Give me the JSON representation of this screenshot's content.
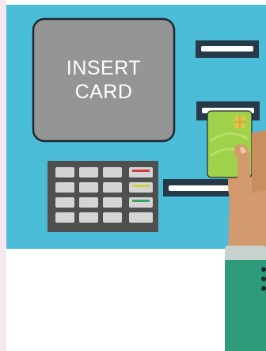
{
  "screen": {
    "line1": "INSERT",
    "line2": "CARD"
  },
  "colors": {
    "atm_body": "#4bbdd8",
    "screen": "#959595",
    "keypad": "#4f4f4f",
    "key": "#d4d4d4",
    "key_red": "#d03a3a",
    "key_yellow": "#cfd03c",
    "key_green": "#3aa55a",
    "card": "#9fd14a",
    "skin": "#d29a6e",
    "sleeve": "#2e9a7c",
    "cuff": "#c7d3cc"
  }
}
